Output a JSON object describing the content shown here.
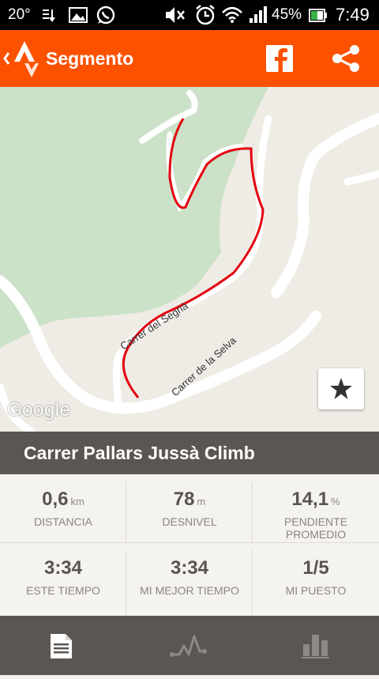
{
  "status_bar": {
    "temperature": "20°",
    "battery": "45%",
    "time": "7:49",
    "icons": [
      "download-icon",
      "image-icon",
      "whatsapp-icon",
      "mute-icon",
      "alarm-icon",
      "wifi-icon",
      "signal-icon",
      "battery-icon"
    ]
  },
  "action_bar": {
    "title": "Segmento",
    "color": "#fc5200",
    "icons": [
      "strava-back-icon",
      "facebook-icon",
      "share-icon"
    ]
  },
  "map": {
    "streets": [
      "Carrer del Segrià",
      "Carrer de la Selva"
    ],
    "attribution": "Google",
    "route_color": "#e4000f",
    "star_icon": "star-icon"
  },
  "segment": {
    "name": "Carrer Pallars Jussà Climb"
  },
  "stats": [
    {
      "value": "0,6",
      "unit": "km",
      "label": "DISTANCIA"
    },
    {
      "value": "78",
      "unit": "m",
      "label": "DESNIVEL"
    },
    {
      "value": "14,1",
      "unit": "%",
      "label": "PENDIENTE PROMEDIO"
    },
    {
      "value": "3:34",
      "unit": "",
      "label": "ESTE TIEMPO"
    },
    {
      "value": "3:34",
      "unit": "",
      "label": "MI MEJOR TIEMPO"
    },
    {
      "value": "1/5",
      "unit": "",
      "label": "MI PUESTO"
    }
  ],
  "bottom_tabs": [
    {
      "name": "details-tab",
      "icon": "document-icon",
      "active": true
    },
    {
      "name": "analysis-tab",
      "icon": "graph-icon",
      "active": false
    },
    {
      "name": "leaderboard-tab",
      "icon": "bar-chart-icon",
      "active": false
    }
  ]
}
